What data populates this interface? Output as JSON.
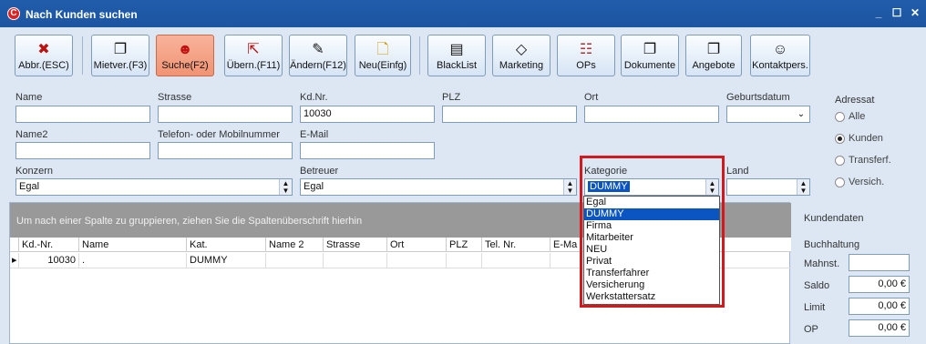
{
  "window": {
    "title": "Nach Kunden suchen",
    "controls": [
      "_",
      "☐",
      "✕"
    ]
  },
  "toolbar": [
    {
      "key": "abbr",
      "label": "Abbr.(ESC)",
      "icon": "x-icon",
      "active": false
    },
    {
      "key": "mietver",
      "label": "Mietver.(F3)",
      "icon": "documents-icon",
      "active": false
    },
    {
      "key": "suche",
      "label": "Suche(F2)",
      "icon": "user-icon",
      "active": true
    },
    {
      "key": "uebern",
      "label": "Übern.(F11)",
      "icon": "transfer-icon",
      "active": false
    },
    {
      "key": "aendern",
      "label": "Ändern(F12)",
      "icon": "edit-icon",
      "active": false
    },
    {
      "key": "neu",
      "label": "Neu(Einfg)",
      "icon": "new-document-icon",
      "active": false
    },
    {
      "key": "blacklist",
      "label": "BlackList",
      "icon": "list-icon",
      "active": false
    },
    {
      "key": "marketing",
      "label": "Marketing",
      "icon": "eraser-icon",
      "active": false
    },
    {
      "key": "ops",
      "label": "OPs",
      "icon": "ledger-icon",
      "active": false
    },
    {
      "key": "dokumente",
      "label": "Dokumente",
      "icon": "documents-icon",
      "active": false
    },
    {
      "key": "angebote",
      "label": "Angebote",
      "icon": "documents-icon",
      "active": false
    },
    {
      "key": "kontakt",
      "label": "Kontaktpers.",
      "icon": "person-icon",
      "active": false
    }
  ],
  "form": {
    "name_label": "Name",
    "name_value": "",
    "strasse_label": "Strasse",
    "strasse_value": "",
    "kdnr_label": "Kd.Nr.",
    "kdnr_value": "10030",
    "plz_label": "PLZ",
    "plz_value": "",
    "ort_label": "Ort",
    "ort_value": "",
    "geburtsdatum_label": "Geburtsdatum",
    "geburtsdatum_value": "",
    "name2_label": "Name2",
    "name2_value": "",
    "telefon_label": "Telefon- oder Mobilnummer",
    "telefon_value": "",
    "email_label": "E-Mail",
    "email_value": "",
    "konzern_label": "Konzern",
    "konzern_value": "Egal",
    "betreuer_label": "Betreuer",
    "betreuer_value": "Egal",
    "kategorie_label": "Kategorie",
    "kategorie_value": "DUMMY",
    "land_label": "Land",
    "land_value": ""
  },
  "kategorie_options": [
    "Egal",
    "DUMMY",
    "Firma",
    "Mitarbeiter",
    "NEU",
    "Privat",
    "Transferfahrer",
    "Versicherung",
    "Werkstattersatz"
  ],
  "kategorie_selected_index": 1,
  "adressat": {
    "legend": "Adressat",
    "options": [
      {
        "label": "Alle",
        "checked": false
      },
      {
        "label": "Kunden",
        "checked": true
      },
      {
        "label": "Transferf.",
        "checked": false
      },
      {
        "label": "Versich.",
        "checked": false
      }
    ]
  },
  "grid": {
    "hint": "Um nach einer Spalte zu gruppieren, ziehen Sie die Spaltenüberschrift hierhin",
    "columns": [
      "Kd.-Nr.",
      "Name",
      "Kat.",
      "Name 2",
      "Strasse",
      "Ort",
      "PLZ",
      "Tel. Nr.",
      "E-Ma"
    ],
    "rows": [
      [
        "10030",
        ".",
        "DUMMY",
        "",
        "",
        "",
        "",
        "",
        ""
      ]
    ]
  },
  "side": {
    "kundendaten": "Kundendaten",
    "buchhaltung": "Buchhaltung",
    "mahnst_label": "Mahnst.",
    "mahnst_value": "",
    "saldo_label": "Saldo",
    "saldo_value": "0,00 €",
    "limit_label": "Limit",
    "limit_value": "0,00 €",
    "op_label": "OP",
    "op_value": "0,00 €"
  }
}
